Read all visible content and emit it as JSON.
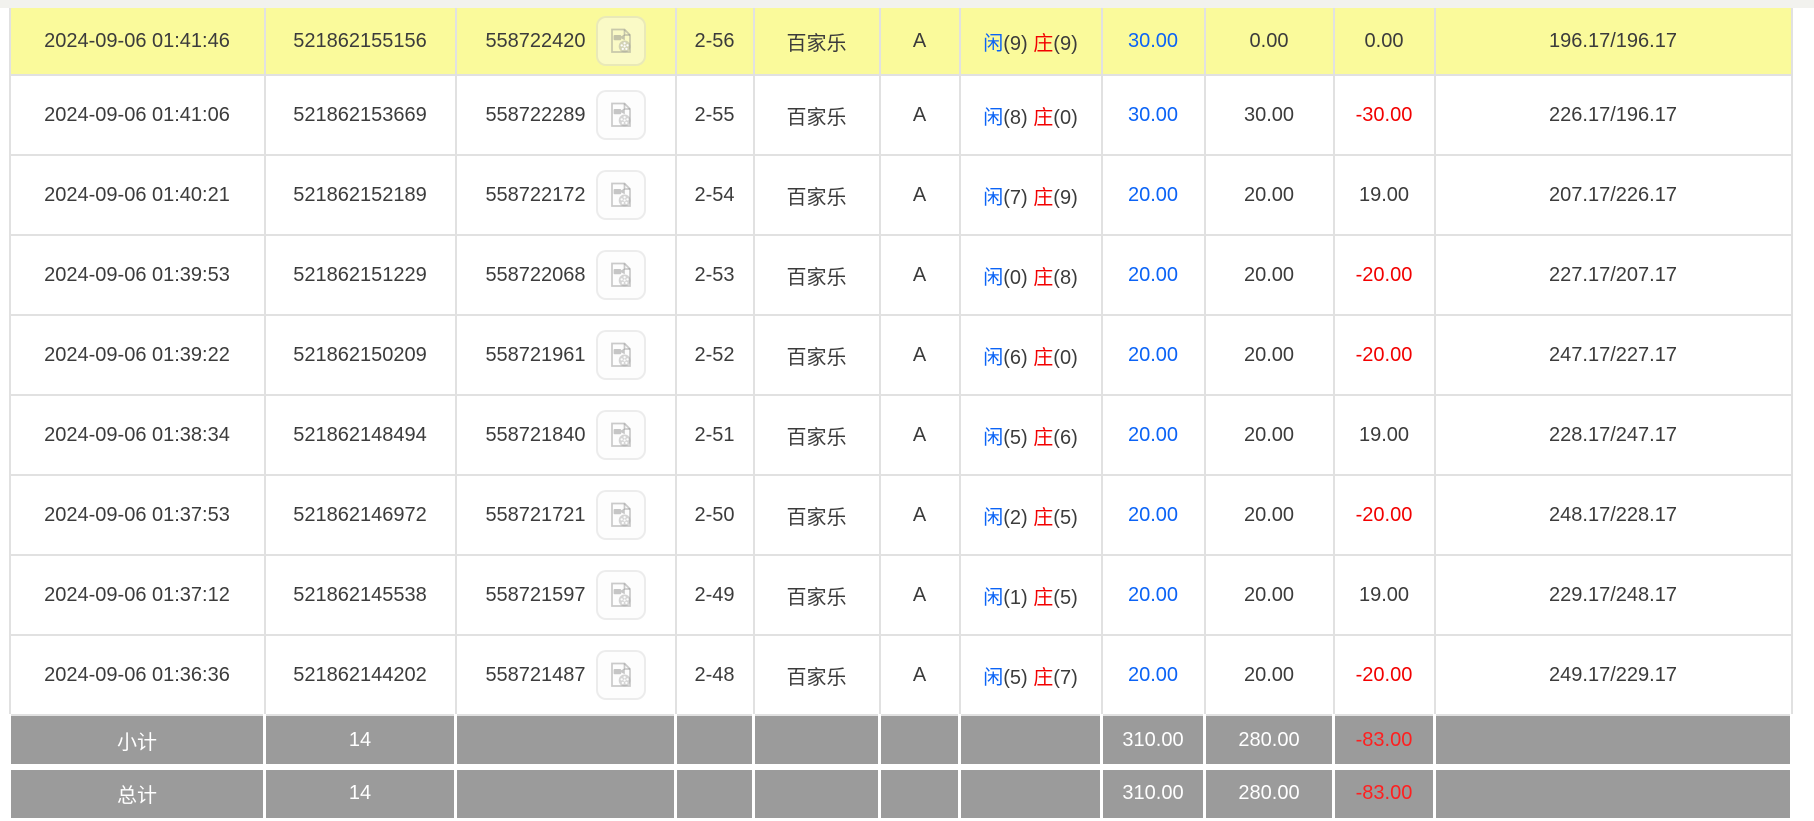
{
  "colors": {
    "highlight_yellow": "#fafa9b",
    "accent_blue": "#0b63f6",
    "accent_red": "#f20000",
    "summary_gray": "#9b9b9b",
    "row_border": "#e1e1e1",
    "top_strip": "#f2f2ee",
    "text": "#3b3b3b",
    "summary_text": "#ffffff"
  },
  "table": {
    "rows": [
      {
        "time": "2024-09-06 01:41:46",
        "order_id": "521862155156",
        "game_id": "558722420",
        "round": "2-56",
        "game": "百家乐",
        "table_code": "A",
        "result": {
          "player_char": "闲",
          "player_score": "(9)",
          "banker_char": "庄",
          "banker_score": "(9)"
        },
        "bet": "30.00",
        "valid": "0.00",
        "win_loss": "0.00",
        "balance": "196.17/196.17",
        "highlighted": true
      },
      {
        "time": "2024-09-06 01:41:06",
        "order_id": "521862153669",
        "game_id": "558722289",
        "round": "2-55",
        "game": "百家乐",
        "table_code": "A",
        "result": {
          "player_char": "闲",
          "player_score": "(8)",
          "banker_char": "庄",
          "banker_score": "(0)"
        },
        "bet": "30.00",
        "valid": "30.00",
        "win_loss": "-30.00",
        "balance": "226.17/196.17",
        "highlighted": false
      },
      {
        "time": "2024-09-06 01:40:21",
        "order_id": "521862152189",
        "game_id": "558722172",
        "round": "2-54",
        "game": "百家乐",
        "table_code": "A",
        "result": {
          "player_char": "闲",
          "player_score": "(7)",
          "banker_char": "庄",
          "banker_score": "(9)"
        },
        "bet": "20.00",
        "valid": "20.00",
        "win_loss": "19.00",
        "balance": "207.17/226.17",
        "highlighted": false
      },
      {
        "time": "2024-09-06 01:39:53",
        "order_id": "521862151229",
        "game_id": "558722068",
        "round": "2-53",
        "game": "百家乐",
        "table_code": "A",
        "result": {
          "player_char": "闲",
          "player_score": "(0)",
          "banker_char": "庄",
          "banker_score": "(8)"
        },
        "bet": "20.00",
        "valid": "20.00",
        "win_loss": "-20.00",
        "balance": "227.17/207.17",
        "highlighted": false
      },
      {
        "time": "2024-09-06 01:39:22",
        "order_id": "521862150209",
        "game_id": "558721961",
        "round": "2-52",
        "game": "百家乐",
        "table_code": "A",
        "result": {
          "player_char": "闲",
          "player_score": "(6)",
          "banker_char": "庄",
          "banker_score": "(0)"
        },
        "bet": "20.00",
        "valid": "20.00",
        "win_loss": "-20.00",
        "balance": "247.17/227.17",
        "highlighted": false
      },
      {
        "time": "2024-09-06 01:38:34",
        "order_id": "521862148494",
        "game_id": "558721840",
        "round": "2-51",
        "game": "百家乐",
        "table_code": "A",
        "result": {
          "player_char": "闲",
          "player_score": "(5)",
          "banker_char": "庄",
          "banker_score": "(6)"
        },
        "bet": "20.00",
        "valid": "20.00",
        "win_loss": "19.00",
        "balance": "228.17/247.17",
        "highlighted": false
      },
      {
        "time": "2024-09-06 01:37:53",
        "order_id": "521862146972",
        "game_id": "558721721",
        "round": "2-50",
        "game": "百家乐",
        "table_code": "A",
        "result": {
          "player_char": "闲",
          "player_score": "(2)",
          "banker_char": "庄",
          "banker_score": "(5)"
        },
        "bet": "20.00",
        "valid": "20.00",
        "win_loss": "-20.00",
        "balance": "248.17/228.17",
        "highlighted": false
      },
      {
        "time": "2024-09-06 01:37:12",
        "order_id": "521862145538",
        "game_id": "558721597",
        "round": "2-49",
        "game": "百家乐",
        "table_code": "A",
        "result": {
          "player_char": "闲",
          "player_score": "(1)",
          "banker_char": "庄",
          "banker_score": "(5)"
        },
        "bet": "20.00",
        "valid": "20.00",
        "win_loss": "19.00",
        "balance": "229.17/248.17",
        "highlighted": false
      },
      {
        "time": "2024-09-06 01:36:36",
        "order_id": "521862144202",
        "game_id": "558721487",
        "round": "2-48",
        "game": "百家乐",
        "table_code": "A",
        "result": {
          "player_char": "闲",
          "player_score": "(5)",
          "banker_char": "庄",
          "banker_score": "(7)"
        },
        "bet": "20.00",
        "valid": "20.00",
        "win_loss": "-20.00",
        "balance": "249.17/229.17",
        "highlighted": false
      }
    ],
    "summary": [
      {
        "label": "小计",
        "count": "14",
        "bet": "310.00",
        "valid": "280.00",
        "win_loss": "-83.00"
      },
      {
        "label": "总计",
        "count": "14",
        "bet": "310.00",
        "valid": "280.00",
        "win_loss": "-83.00"
      }
    ],
    "icons": {
      "video_icon_name": "video-file-icon"
    }
  }
}
